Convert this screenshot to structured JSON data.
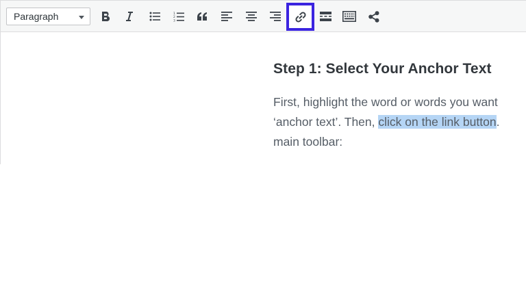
{
  "toolbar": {
    "format_select": {
      "value": "Paragraph"
    },
    "buttons": [
      {
        "name": "bold-button",
        "icon": "bold-icon"
      },
      {
        "name": "italic-button",
        "icon": "italic-icon"
      },
      {
        "name": "bulleted-list-button",
        "icon": "bulleted-list-icon"
      },
      {
        "name": "numbered-list-button",
        "icon": "numbered-list-icon"
      },
      {
        "name": "blockquote-button",
        "icon": "blockquote-icon"
      },
      {
        "name": "align-left-button",
        "icon": "align-left-icon"
      },
      {
        "name": "align-center-button",
        "icon": "align-center-icon"
      },
      {
        "name": "align-right-button",
        "icon": "align-right-icon"
      },
      {
        "name": "insert-link-button",
        "icon": "link-icon",
        "highlighted": true
      },
      {
        "name": "read-more-button",
        "icon": "read-more-icon"
      },
      {
        "name": "toolbar-toggle-button",
        "icon": "keyboard-icon"
      },
      {
        "name": "share-button",
        "icon": "share-icon"
      }
    ],
    "highlight_color": "#3b24e0"
  },
  "content": {
    "heading": "Step 1: Select Your Anchor Text",
    "paragraph": {
      "line1": "First, highlight the word or words you want",
      "line2_before": "‘anchor text’. Then, ",
      "line2_selected": "click on the link button",
      "line2_after": ".",
      "line3": "main toolbar:"
    },
    "selection_color": "#b5d5f5"
  }
}
